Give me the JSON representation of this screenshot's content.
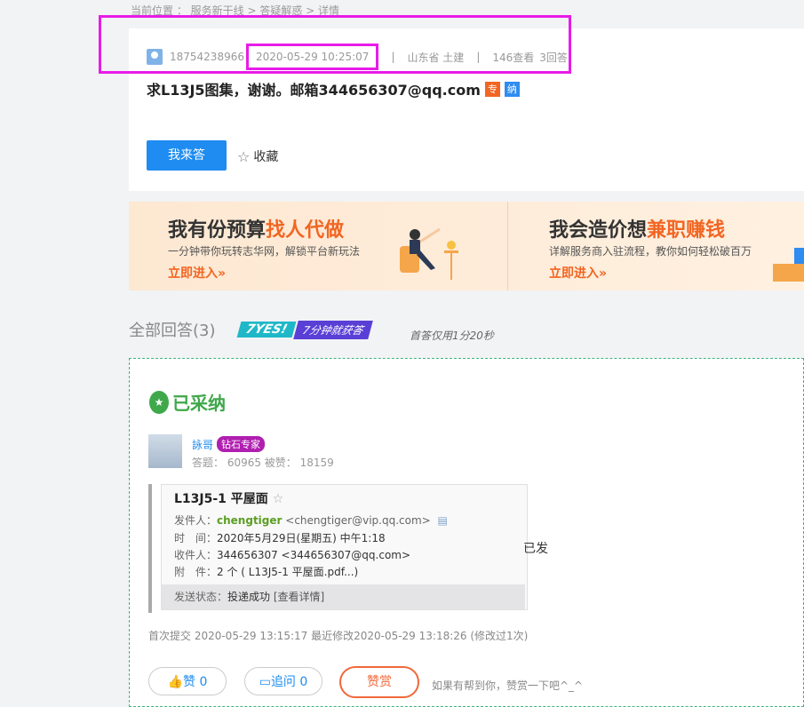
{
  "breadcrumb": "当前位置 ： 服务新干线 > 答疑解惑 > 详情",
  "question": {
    "user": "18754238966",
    "date": "2020-05-29 10:25:07",
    "location": "山东省 土建",
    "views": "146查看",
    "answers": "3回答",
    "title": "求L13J5图集，谢谢。邮箱344656307@qq.com",
    "tag_zhuan": "专",
    "tag_na": "纳",
    "answer_button": "我来答",
    "favorite": "收藏"
  },
  "banner": {
    "left_title_a": "我有份预算",
    "left_title_b": "找人代做",
    "left_sub": "一分钟带你玩转志华网，解锁平台新玩法",
    "left_enter": "立即进入»",
    "right_title_a": "我会造价想",
    "right_title_b": "兼职赚钱",
    "right_sub": "详解服务商入驻流程，教你如何轻松破百万",
    "right_enter": "立即进入»"
  },
  "answers_header": {
    "title": "全部回答(3)",
    "yes_badge": "7YES!",
    "yes_sub": "7分钟就获答",
    "fast_note": "首答仅用1分20秒"
  },
  "answer": {
    "accepted_label": "已采纳",
    "user": "詠哥",
    "user_badge": "钻石专家",
    "stats": "答题： 60965    被赞： 18159",
    "mail": {
      "title": "L13J5-1 平屋面",
      "from_label": "发件人：",
      "from_name": "chengtiger",
      "from_addr": "<chengtiger@vip.qq.com>",
      "time_label": "时　间：",
      "time_value": "2020年5月29日(星期五) 中午1:18",
      "to_label": "收件人：",
      "to_value": "344656307 <344656307@qq.com>",
      "attach_label": "附　件：",
      "attach_value": "2 个 ( L13J5-1 平屋面.pdf...)",
      "status_label": "发送状态：",
      "status_value": "投递成功",
      "status_link": "[查看详情]"
    },
    "sent_text": "已发",
    "times": "首次提交 2020-05-29 13:15:17   最近修改2020-05-29 13:18:26 (修改过1次)",
    "like": "赞 0",
    "followup": "追问  0",
    "reward": "赞赏",
    "reward_hint": "如果有帮到你，赞赏一下吧^_^"
  }
}
